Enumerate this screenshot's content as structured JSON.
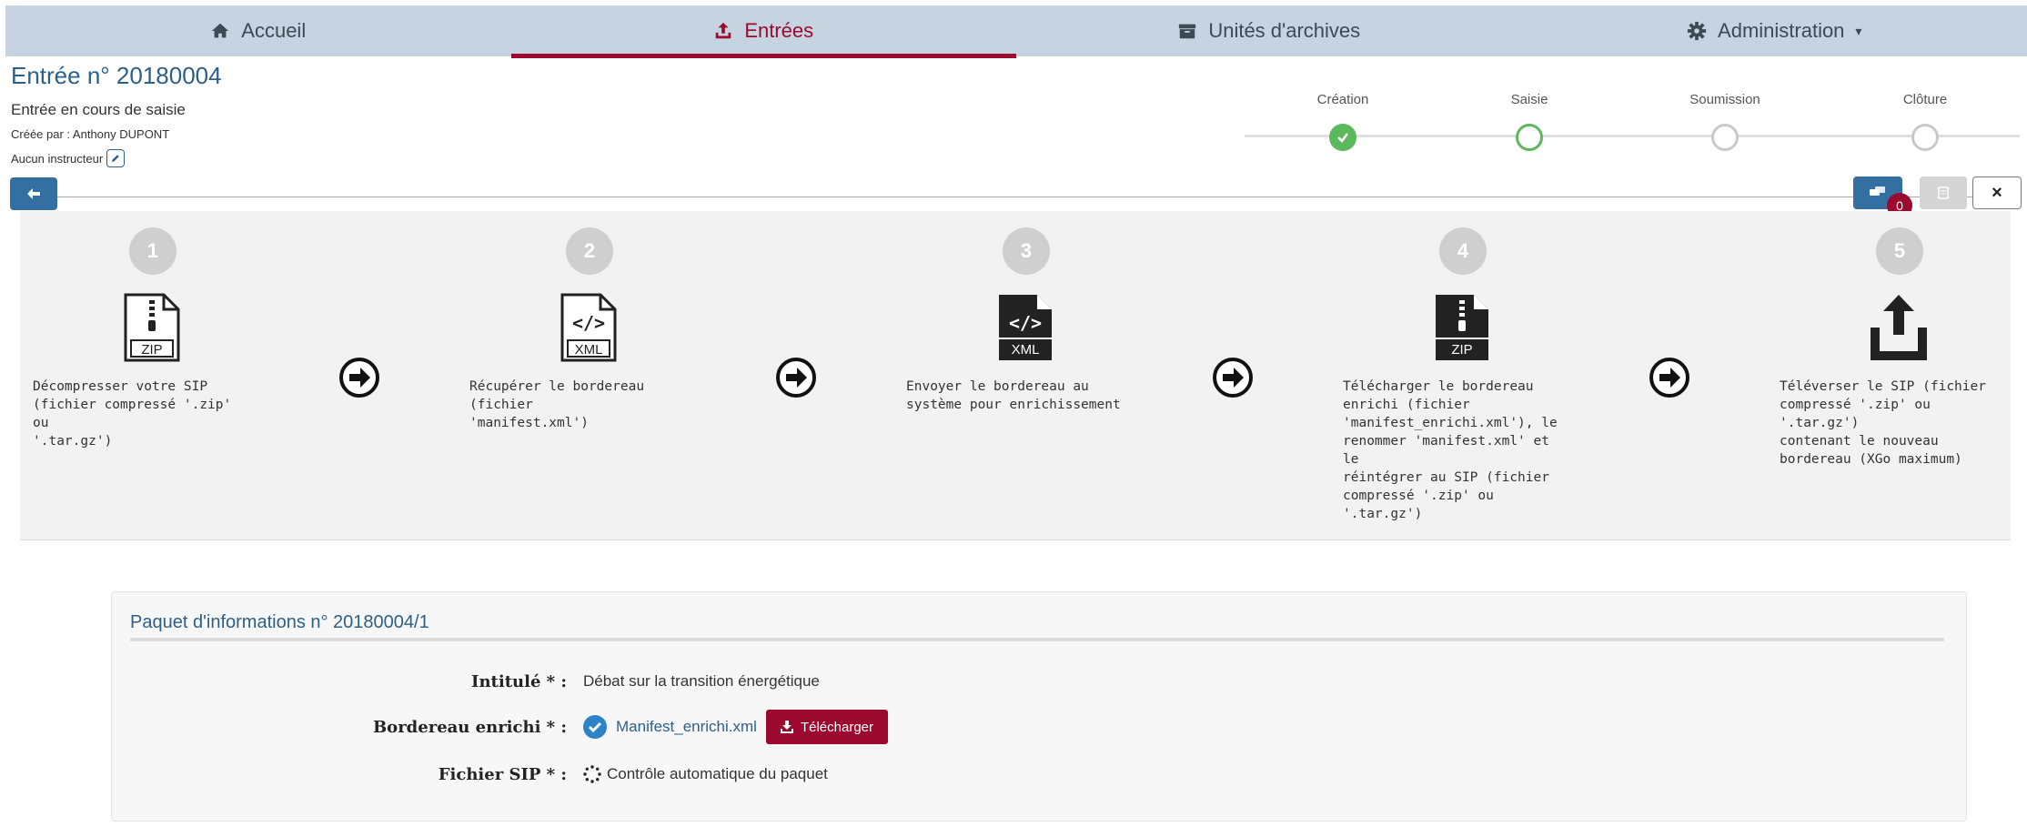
{
  "nav": {
    "items": [
      {
        "label": "Accueil",
        "icon": "home-icon"
      },
      {
        "label": "Entrées",
        "icon": "upload-icon"
      },
      {
        "label": "Unités d'archives",
        "icon": "archive-box-icon"
      },
      {
        "label": "Administration",
        "icon": "gear-icon"
      }
    ],
    "active_index": 1,
    "admin_caret": "▾",
    "accent": "#9b0a2e"
  },
  "header": {
    "title": "Entrée n° 20180004",
    "status": "Entrée en cours de saisie",
    "created_by": "Créée par : Anthony DUPONT",
    "instructor": "Aucun instructeur"
  },
  "stepper": {
    "steps": [
      {
        "label": "Création",
        "state": "done"
      },
      {
        "label": "Saisie",
        "state": "current"
      },
      {
        "label": "Soumission",
        "state": "pending"
      },
      {
        "label": "Clôture",
        "state": "pending"
      }
    ]
  },
  "toolbar": {
    "comments_count": "0",
    "close_label": "×"
  },
  "procedure": {
    "steps": [
      {
        "number": "1",
        "icon": "zip-file-icon",
        "text": "Décompresser votre SIP\n(fichier compressé '.zip' ou\n'.tar.gz')"
      },
      {
        "number": "2",
        "icon": "xml-file-icon",
        "text": "Récupérer le bordereau (fichier\n'manifest.xml')"
      },
      {
        "number": "3",
        "icon": "xml-file-dark-icon",
        "text": "Envoyer le bordereau au\nsystème pour enrichissement"
      },
      {
        "number": "4",
        "icon": "zip-file-dark-icon",
        "text": "Télécharger le bordereau\nenrichi (fichier\n'manifest_enrichi.xml'), le\nrenommer 'manifest.xml' et le\nréintégrer au SIP (fichier\ncompressé '.zip' ou '.tar.gz')"
      },
      {
        "number": "5",
        "icon": "upload-tray-icon",
        "text": "Téléverser le SIP (fichier\ncompressé '.zip' ou '.tar.gz')\ncontenant le nouveau\nbordereau (XGo maximum)"
      }
    ],
    "file_tags": {
      "zip": "ZIP",
      "xml": "XML"
    }
  },
  "info": {
    "title": "Paquet d'informations n° 20180004/1",
    "intitule_label": "Intitulé * :",
    "intitule_value": "Débat sur la transition énergétique",
    "bordereau_label": "Bordereau enrichi * :",
    "bordereau_link": "Manifest_enrichi.xml",
    "download_label": "Télécharger",
    "sip_label": "Fichier SIP * :",
    "sip_status": "Contrôle automatique du paquet"
  }
}
